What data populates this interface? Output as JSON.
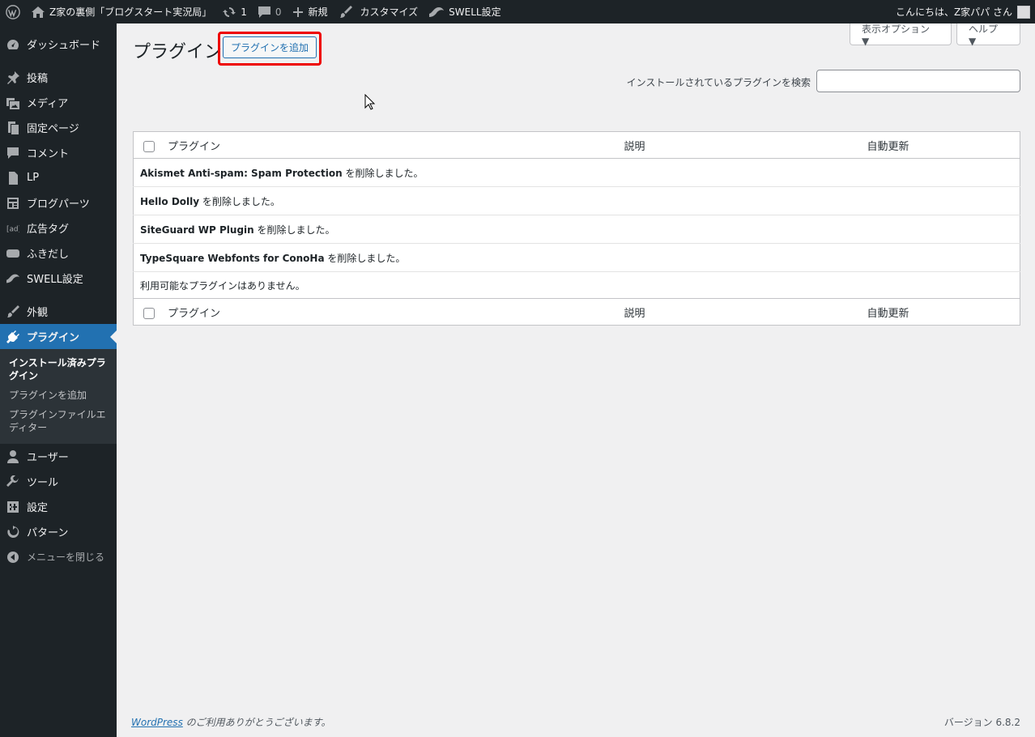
{
  "adminbar": {
    "site_name": "Z家の裏側「ブログスタート実況局」",
    "updates_count": "1",
    "comments_count": "0",
    "new_label": "新規",
    "customize_label": "カスタマイズ",
    "swell_label": "SWELL設定",
    "greeting": "こんにちは、Z家パパ さん"
  },
  "sidebar": {
    "items": [
      {
        "label": "ダッシュボード",
        "icon": "dashboard-icon"
      },
      {
        "label": "投稿",
        "icon": "pin-icon"
      },
      {
        "label": "メディア",
        "icon": "media-icon"
      },
      {
        "label": "固定ページ",
        "icon": "page-icon"
      },
      {
        "label": "コメント",
        "icon": "comment-icon"
      },
      {
        "label": "LP",
        "icon": "doc-icon"
      },
      {
        "label": "ブログパーツ",
        "icon": "blog-parts-icon"
      },
      {
        "label": "広告タグ",
        "icon": "ad-icon"
      },
      {
        "label": "ふきだし",
        "icon": "balloon-icon"
      },
      {
        "label": "SWELL設定",
        "icon": "swell-icon"
      },
      {
        "label": "外観",
        "icon": "brush-icon"
      },
      {
        "label": "プラグイン",
        "icon": "plugin-icon"
      },
      {
        "label": "ユーザー",
        "icon": "user-icon"
      },
      {
        "label": "ツール",
        "icon": "wrench-icon"
      },
      {
        "label": "設定",
        "icon": "settings-icon"
      },
      {
        "label": "パターン",
        "icon": "pattern-icon"
      }
    ],
    "submenu": [
      "インストール済みプラグイン",
      "プラグインを追加",
      "プラグインファイルエディター"
    ],
    "collapse_label": "メニューを閉じる"
  },
  "header": {
    "title": "プラグイン",
    "add_button": "プラグインを追加",
    "screen_options": "表示オプション ▼",
    "help": "ヘルプ ▼",
    "search_label": "インストールされているプラグインを検索",
    "search_value": ""
  },
  "table": {
    "columns": [
      "プラグイン",
      "説明",
      "自動更新"
    ],
    "rows": [
      {
        "name": "Akismet Anti-spam: Spam Protection",
        "message": " を削除しました。"
      },
      {
        "name": "Hello Dolly",
        "message": " を削除しました。"
      },
      {
        "name": "SiteGuard WP Plugin",
        "message": " を削除しました。"
      },
      {
        "name": "TypeSquare Webfonts for ConoHa",
        "message": " を削除しました。"
      }
    ],
    "empty_message": "利用可能なプラグインはありません。"
  },
  "footer": {
    "wordpress_link": "WordPress",
    "thanks": " のご利用ありがとうございます。",
    "version": "バージョン 6.8.2"
  }
}
